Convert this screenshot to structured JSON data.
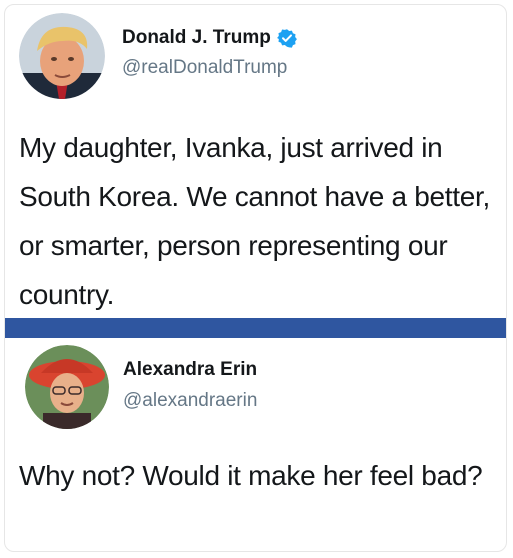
{
  "tweets": [
    {
      "display_name": "Donald J. Trump",
      "handle": "@realDonaldTrump",
      "verified": true,
      "text": "My daughter, Ivanka, just arrived in South Korea. We cannot have a better, or smarter, person representing our country."
    },
    {
      "display_name": "Alexandra Erin",
      "handle": "@alexandraerin",
      "verified": false,
      "text": "Why not? Would it make her feel bad?"
    }
  ],
  "colors": {
    "divider": "#2f56a0",
    "verified_badge": "#1da1f2",
    "handle": "#657786"
  },
  "icons": {
    "verified": "verified-badge-icon"
  }
}
